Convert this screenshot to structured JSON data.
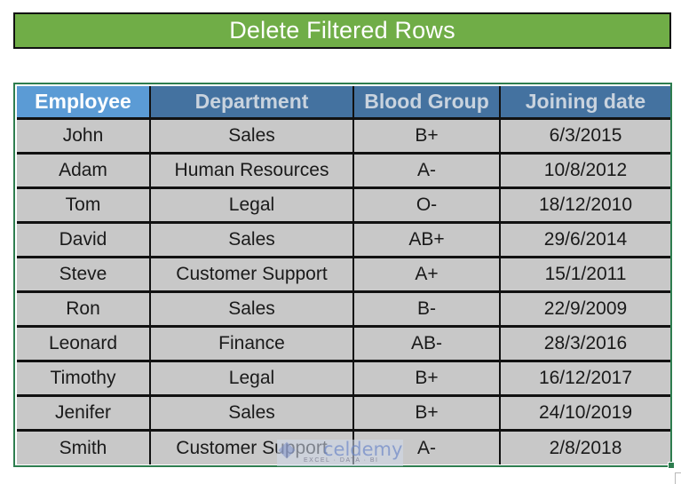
{
  "title": "Delete Filtered Rows",
  "colors": {
    "title_bg": "#70AD47",
    "header_first_bg": "#5B9BD5",
    "header_bg": "#4472A0",
    "cell_bg": "#C8C8C8",
    "selection_border": "#2E7D4F"
  },
  "table": {
    "headers": [
      "Employee",
      "Department",
      "Blood Group",
      "Joining date"
    ],
    "rows": [
      [
        "John",
        "Sales",
        "B+",
        "6/3/2015"
      ],
      [
        "Adam",
        "Human Resources",
        "A-",
        "10/8/2012"
      ],
      [
        "Tom",
        "Legal",
        "O-",
        "18/12/2010"
      ],
      [
        "David",
        "Sales",
        "AB+",
        "29/6/2014"
      ],
      [
        "Steve",
        "Customer Support",
        "A+",
        "15/1/2011"
      ],
      [
        "Ron",
        "Sales",
        "B-",
        "22/9/2009"
      ],
      [
        "Leonard",
        "Finance",
        "AB-",
        "28/3/2016"
      ],
      [
        "Timothy",
        "Legal",
        "B+",
        "16/12/2017"
      ],
      [
        "Jenifer",
        "Sales",
        "B+",
        "24/10/2019"
      ],
      [
        "Smith",
        "Customer Support",
        "A-",
        "2/8/2018"
      ]
    ]
  },
  "watermark": {
    "brand": "exceldemy",
    "brand_visible": "celdemy",
    "tagline": "EXCEL · DATA · BI"
  }
}
